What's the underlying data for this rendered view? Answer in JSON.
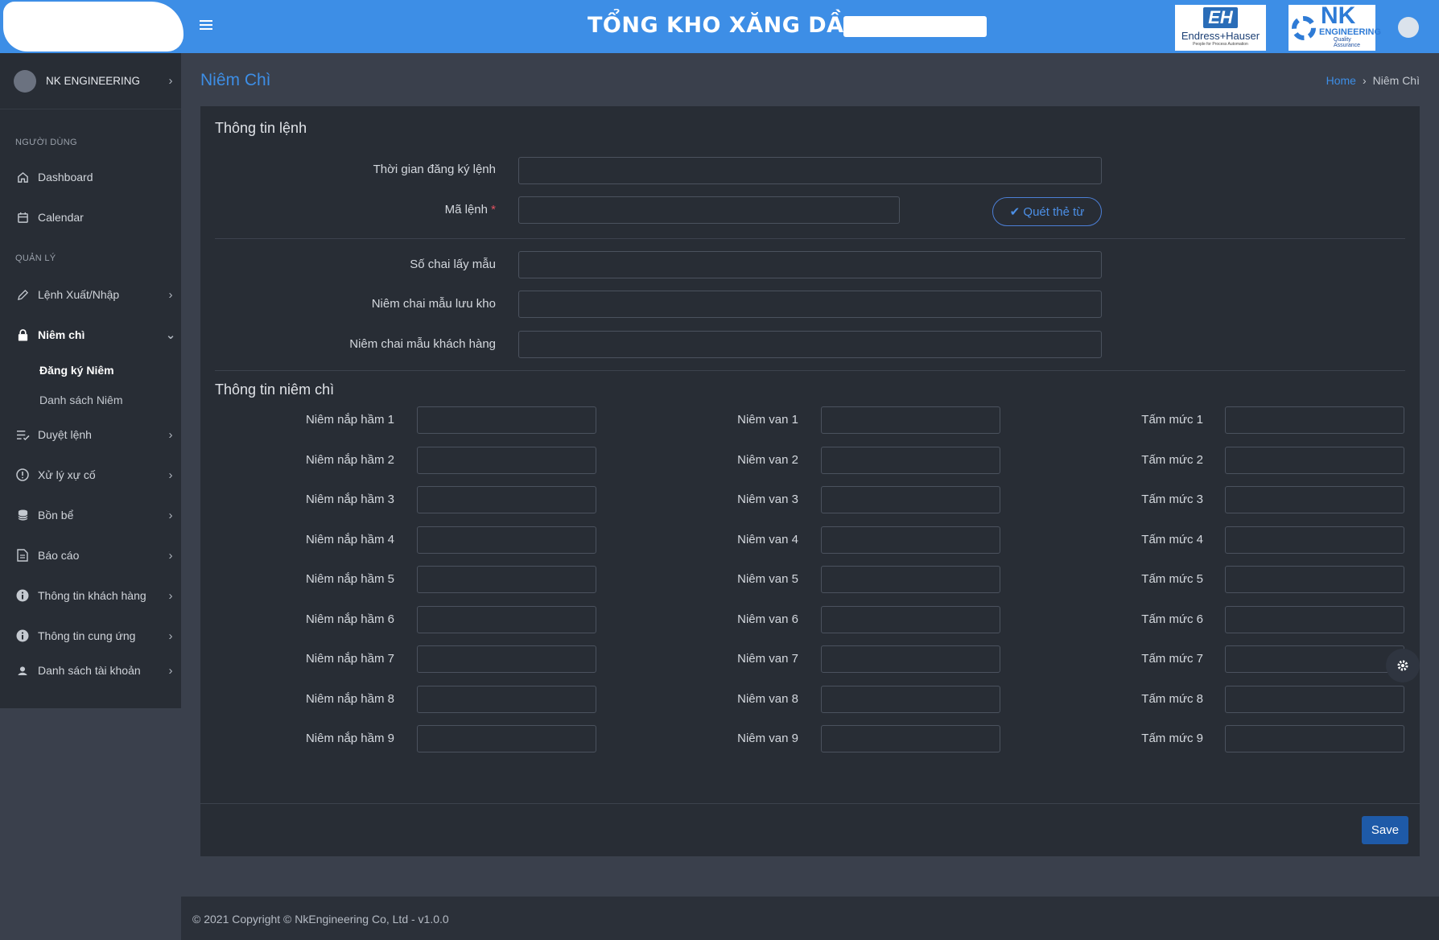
{
  "header": {
    "title": "TỔNG KHO XĂNG DẦU",
    "menu_icon": "hamburger-icon",
    "logo_eh": {
      "mark": "EH",
      "name": "Endress+Hauser",
      "tagline": "People for Process Automation"
    },
    "logo_nk": {
      "mark": "NK",
      "name": "ENGINEERING",
      "tagline": "Quality Assurance"
    },
    "accent": "#3d8ee6"
  },
  "sidebar": {
    "profile_name": "NK ENGINEERING",
    "section_users": "NGƯỜI DÙNG",
    "dashboard": "Dashboard",
    "calendar": "Calendar",
    "section_manage": "QUẢN LÝ",
    "lenh": "Lệnh Xuất/Nhập",
    "niem_chi": "Niêm chì",
    "dang_ky": "Đăng ký Niêm",
    "danh_sach": "Danh sách Niêm",
    "duyet": "Duyệt lệnh",
    "xu_ly": "Xử lý xự cố",
    "bon_be": "Bồn bể",
    "bao_cao": "Báo cáo",
    "khach_hang": "Thông tin khách hàng",
    "cung_ung": "Thông tin cung ứng",
    "tai_khoan": "Danh sách tài khoản"
  },
  "page": {
    "title": "Niêm Chì",
    "breadcrumb_home": "Home",
    "breadcrumb_sep": "›",
    "breadcrumb_current": "Niêm Chì"
  },
  "form": {
    "section1_title": "Thông tin lệnh",
    "thoi_gian_label": "Thời gian đăng ký lệnh",
    "thoi_gian_value": "",
    "ma_lenh_label": "Mã lệnh",
    "ma_lenh_required": "*",
    "ma_lenh_value": "",
    "scan_button": "Quét thẻ từ",
    "so_chai_label": "Số chai lấy mẫu",
    "so_chai_value": "",
    "luu_kho_label": "Niêm chai mẫu lưu kho",
    "luu_kho_value": "",
    "khach_hang_label": "Niêm chai mẫu khách hàng",
    "khach_hang_value": "",
    "section2_title": "Thông tin niêm chì",
    "nap_ham": [
      "Niêm nắp hầm 1",
      "Niêm nắp hầm 2",
      "Niêm nắp hầm 3",
      "Niêm nắp hầm 4",
      "Niêm nắp hầm 5",
      "Niêm nắp hầm 6",
      "Niêm nắp hầm 7",
      "Niêm nắp hầm 8",
      "Niêm nắp hầm 9"
    ],
    "van": [
      "Niêm van 1",
      "Niêm van 2",
      "Niêm van 3",
      "Niêm van 4",
      "Niêm van 5",
      "Niêm van 6",
      "Niêm van 7",
      "Niêm van 8",
      "Niêm van 9"
    ],
    "tam_muc": [
      "Tấm mức 1",
      "Tấm mức 2",
      "Tấm mức 3",
      "Tấm mức 4",
      "Tấm mức 5",
      "Tấm mức 6",
      "Tấm mức 7",
      "Tấm mức 8",
      "Tấm mức 9"
    ],
    "save_button": "Save"
  },
  "footer": {
    "text": "© 2021 Copyright © NkEngineering Co, Ltd - v1.0.0"
  }
}
